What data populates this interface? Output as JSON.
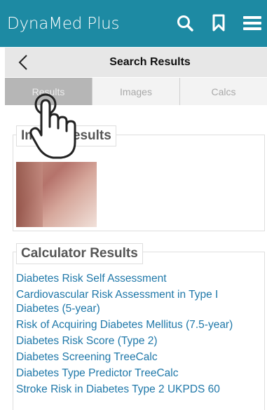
{
  "header": {
    "brand": "DynaMed Plus",
    "icons": [
      "search-icon",
      "bookmark-icon",
      "menu-icon"
    ],
    "color": "#1d8aa3"
  },
  "subheader": {
    "title": "Search Results"
  },
  "tabs": [
    {
      "label": "Results",
      "active": true
    },
    {
      "label": "Images",
      "active": false
    },
    {
      "label": "Calcs",
      "active": false
    }
  ],
  "image_results": {
    "title": "Image Results"
  },
  "calculator_results": {
    "title": "Calculator Results",
    "items": [
      "Diabetes Risk Self Assessment",
      "Cardiovascular Risk Assessment in Type I Diabetes (5-year)",
      "Risk of Acquiring Diabetes Mellitus (7.5-year)",
      "Diabetes Risk Score (Type 2)",
      "Diabetes Screening TreeCalc",
      "Diabetes Type Predictor TreeCalc",
      "Stroke Risk in Diabetes Type 2 UKPDS 60"
    ],
    "link_color": "#1f78a9"
  }
}
